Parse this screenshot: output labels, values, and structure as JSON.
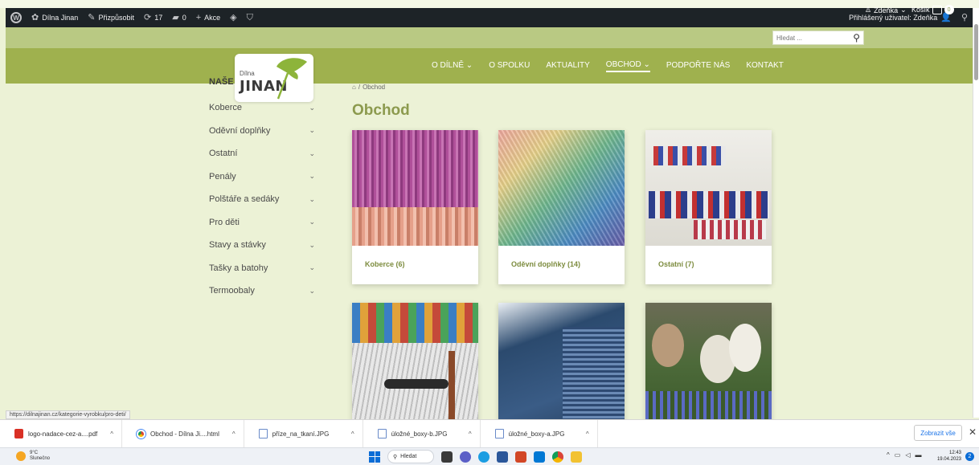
{
  "adminbar": {
    "site_name": "Dílna Jinan",
    "customize": "Přizpůsobit",
    "updates_count": "17",
    "comments_count": "0",
    "new_label": "Akce",
    "logged_in": "Přihlášený uživatel: Zdeňka"
  },
  "utility": {
    "search_placeholder": "Hledat ...",
    "user_label": "Zdeňka",
    "cart_label": "Košík",
    "cart_count": "0"
  },
  "nav": {
    "items": [
      {
        "label": "O DÍLNĚ",
        "dropdown": true
      },
      {
        "label": "O SPOLKU",
        "dropdown": false
      },
      {
        "label": "AKTUALITY",
        "dropdown": false
      },
      {
        "label": "OBCHOD",
        "dropdown": true
      },
      {
        "label": "PODPOŘTE NÁS",
        "dropdown": false
      },
      {
        "label": "KONTAKT",
        "dropdown": false
      }
    ]
  },
  "logo": {
    "small": "Dílna",
    "main": "JINAN"
  },
  "sidebar": {
    "heading": "NAŠE",
    "items": [
      {
        "label": "Koberce"
      },
      {
        "label": "Oděvní doplňky"
      },
      {
        "label": "Ostatní"
      },
      {
        "label": "Penály"
      },
      {
        "label": "Polštáře a sedáky"
      },
      {
        "label": "Pro děti"
      },
      {
        "label": "Stavy a stávky"
      },
      {
        "label": "Tašky a batohy"
      },
      {
        "label": "Termoobaly"
      }
    ]
  },
  "content": {
    "breadcrumb_current": "Obchod",
    "title": "Obchod",
    "categories": [
      {
        "label": "Koberce (6)"
      },
      {
        "label": "Oděvní doplňky (14)"
      },
      {
        "label": "Ostatní (7)"
      }
    ]
  },
  "status_url": "https://dilnajinan.cz/kategorie-vyrobku/pro-deti/",
  "downloads": {
    "items": [
      {
        "name": "logo-nadace-cez-a....pdf",
        "type": "pdf"
      },
      {
        "name": "Obchod - Dílna Ji....html",
        "type": "chrome"
      },
      {
        "name": "příze_na_tkaní.JPG",
        "type": "file"
      },
      {
        "name": "úložné_boxy-b.JPG",
        "type": "file"
      },
      {
        "name": "úložné_boxy-a.JPG",
        "type": "file"
      }
    ],
    "show_all": "Zobrazit vše"
  },
  "taskbar": {
    "temperature": "9°C",
    "weather": "Slunečno",
    "search_label": "Hledat",
    "time": "12:43",
    "date": "19.04.2023",
    "notifications": "2"
  }
}
